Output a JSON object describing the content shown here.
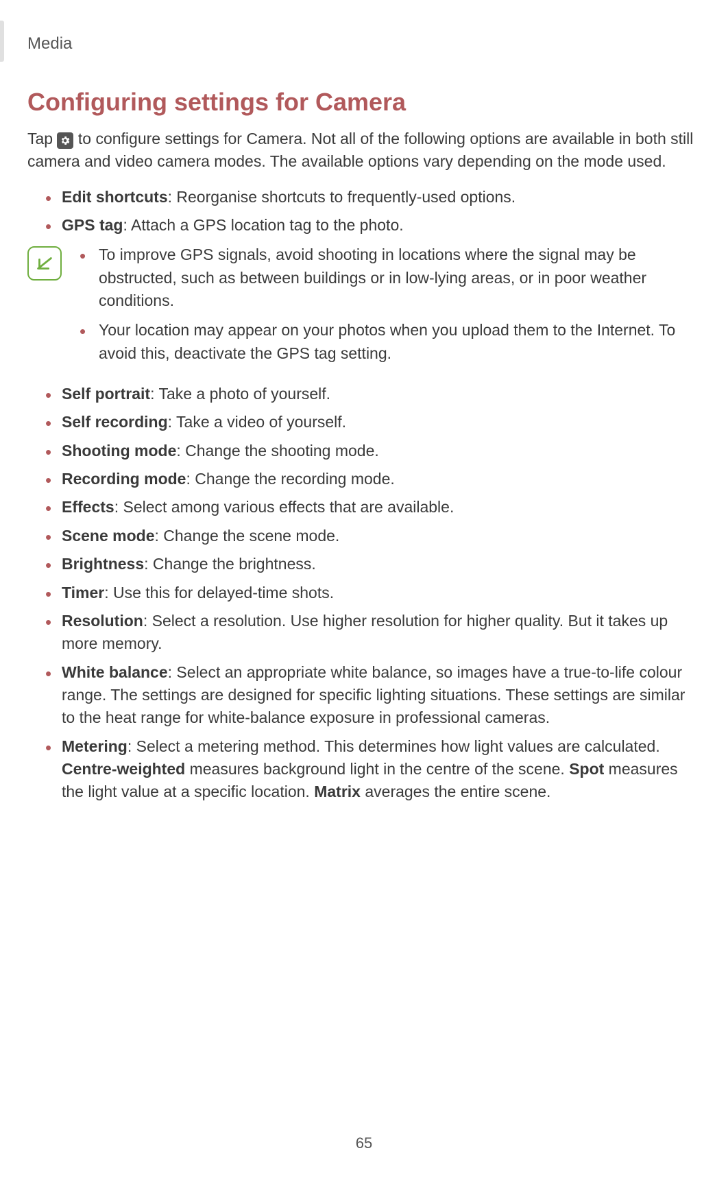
{
  "header": "Media",
  "title": "Configuring settings for Camera",
  "intro_pre": "Tap ",
  "intro_post": " to configure settings for Camera. Not all of the following options are available in both still camera and video camera modes. The available options vary depending on the mode used.",
  "settings_group1": [
    {
      "term": "Edit shortcuts",
      "desc": ": Reorganise shortcuts to frequently-used options."
    },
    {
      "term": "GPS tag",
      "desc": ": Attach a GPS location tag to the photo."
    }
  ],
  "notes": [
    "To improve GPS signals, avoid shooting in locations where the signal may be obstructed, such as between buildings or in low-lying areas, or in poor weather conditions.",
    "Your location may appear on your photos when you upload them to the Internet. To avoid this, deactivate the GPS tag setting."
  ],
  "settings_group2": [
    {
      "term": "Self portrait",
      "desc": ": Take a photo of yourself."
    },
    {
      "term": "Self recording",
      "desc": ": Take a video of yourself."
    },
    {
      "term": "Shooting mode",
      "desc": ": Change the shooting mode."
    },
    {
      "term": "Recording mode",
      "desc": ": Change the recording mode."
    },
    {
      "term": "Effects",
      "desc": ": Select among various effects that are available."
    },
    {
      "term": "Scene mode",
      "desc": ": Change the scene mode."
    },
    {
      "term": "Brightness",
      "desc": ": Change the brightness."
    },
    {
      "term": "Timer",
      "desc": ": Use this for delayed-time shots."
    },
    {
      "term": "Resolution",
      "desc": ": Select a resolution. Use higher resolution for higher quality. But it takes up more memory."
    },
    {
      "term": "White balance",
      "desc": ": Select an appropriate white balance, so images have a true-to-life colour range. The settings are designed for specific lighting situations. These settings are similar to the heat range for white-balance exposure in professional cameras."
    }
  ],
  "metering": {
    "term": "Metering",
    "lead": ": Select a metering method. This determines how light values are calculated. ",
    "b1": "Centre-weighted",
    "t1": " measures background light in the centre of the scene. ",
    "b2": "Spot",
    "t2": " measures the light value at a specific location. ",
    "b3": "Matrix",
    "t3": " averages the entire scene."
  },
  "page_number": "65"
}
